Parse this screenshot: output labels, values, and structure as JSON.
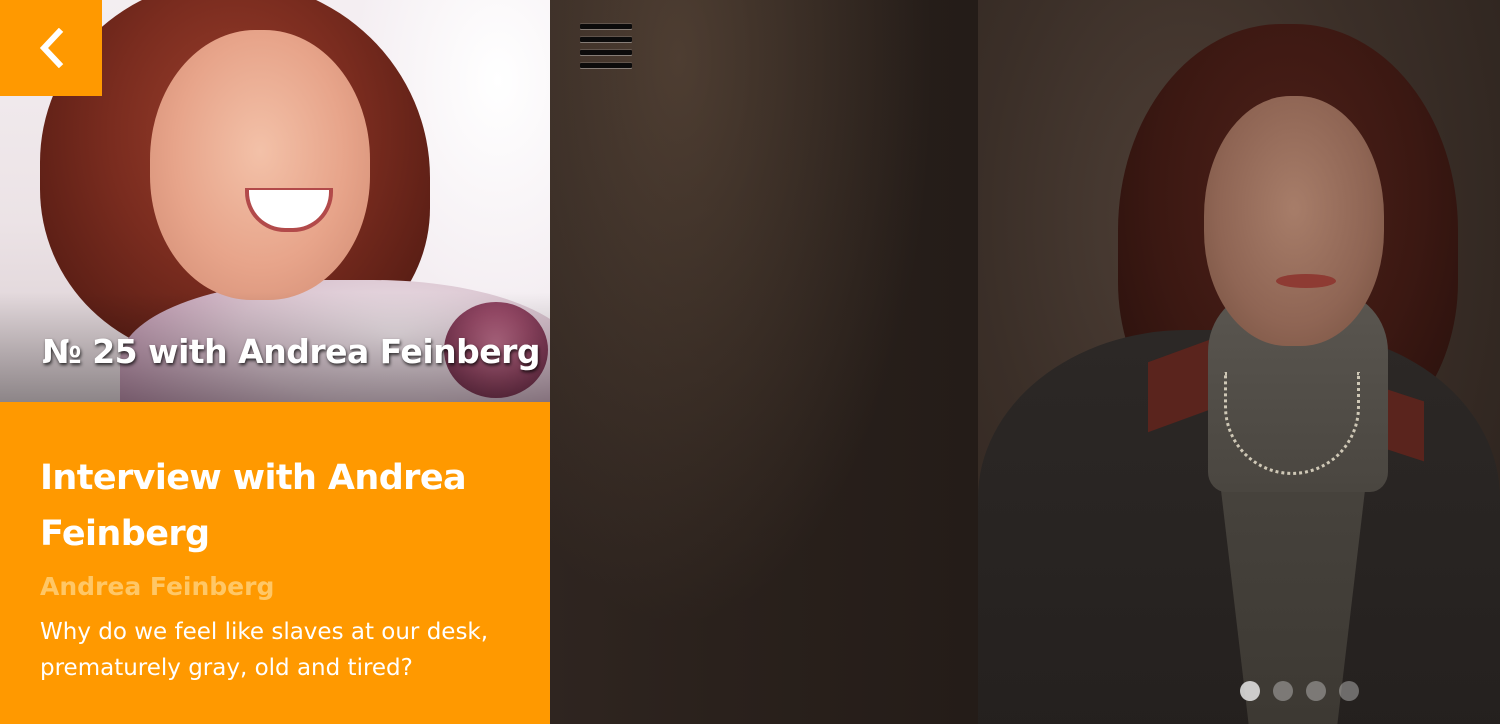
{
  "nav": {
    "back_icon": "chevron-left-icon",
    "menu_icon": "hamburger-menu-icon"
  },
  "hero": {
    "caption": "№ 25 with Andrea Feinberg"
  },
  "article": {
    "title": "Interview with Andrea Feinberg",
    "author": "Andrea Feinberg",
    "excerpt": "Why do we feel like slaves at our desk, prematurely gray, old and tired?"
  },
  "pager": {
    "count": 4,
    "active_index": 0
  },
  "colors": {
    "accent": "#ff9900",
    "author_text": "#ffc766",
    "text": "#ffffff",
    "dark_bg": "#231c18"
  }
}
